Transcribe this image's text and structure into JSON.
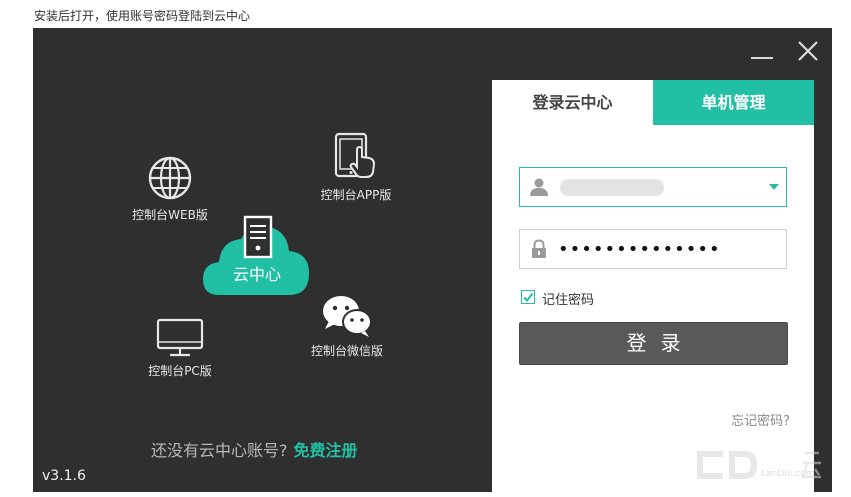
{
  "caption": "安装后打开，使用账号密码登陆到云中心",
  "window": {
    "features": {
      "web": "控制台WEB版",
      "app": "控制台APP版",
      "cloud": "云中心",
      "wechat": "控制台微信版",
      "pc": "控制台PC版"
    },
    "register_prompt": "还没有云中心账号?",
    "register_link": "免费注册",
    "version": "v3.1.6"
  },
  "login_panel": {
    "tabs": [
      {
        "label": "登录云中心",
        "active": true
      },
      {
        "label": "单机管理",
        "active": false
      }
    ],
    "username_value": "",
    "password_value": "••••••••••••••",
    "remember_label": "记住密码",
    "remember_checked": true,
    "login_label": "登录",
    "forgot_label": "忘记密码?"
  },
  "watermark": "LanDui.com",
  "colors": {
    "accent": "#21c0a4",
    "window_bg": "#2f2f2f",
    "button_bg": "#595959"
  }
}
